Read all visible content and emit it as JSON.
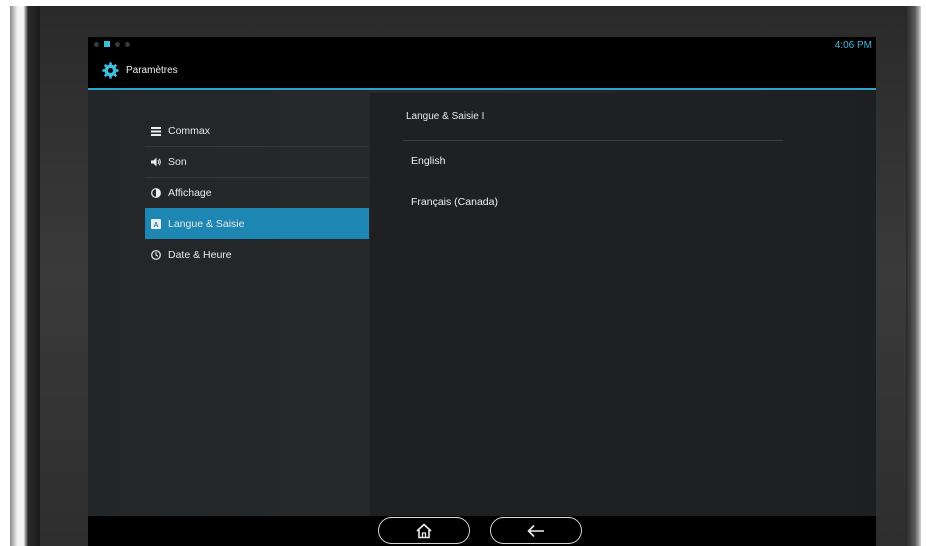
{
  "status_bar": {
    "time": "4:06 PM"
  },
  "action_bar": {
    "title": "Paramètres",
    "icon": "gear-icon",
    "accent_color": "#2aa3cf"
  },
  "settings_menu": {
    "items": [
      {
        "label": "Commax",
        "icon": "list-icon",
        "selected": false
      },
      {
        "label": "Son",
        "icon": "speaker-icon",
        "selected": false
      },
      {
        "label": "Affichage",
        "icon": "contrast-icon",
        "selected": false
      },
      {
        "label": "Langue & Saisie",
        "icon": "language-icon",
        "selected": true
      },
      {
        "label": "Date & Heure",
        "icon": "clock-icon",
        "selected": false
      }
    ],
    "selected_color": "#1e86b3"
  },
  "language_panel": {
    "header": "Langue & Saisie I",
    "options": [
      "English",
      "Français (Canada)"
    ]
  },
  "nav_bar": {
    "buttons": [
      "home-icon",
      "back-arrow-icon"
    ]
  }
}
